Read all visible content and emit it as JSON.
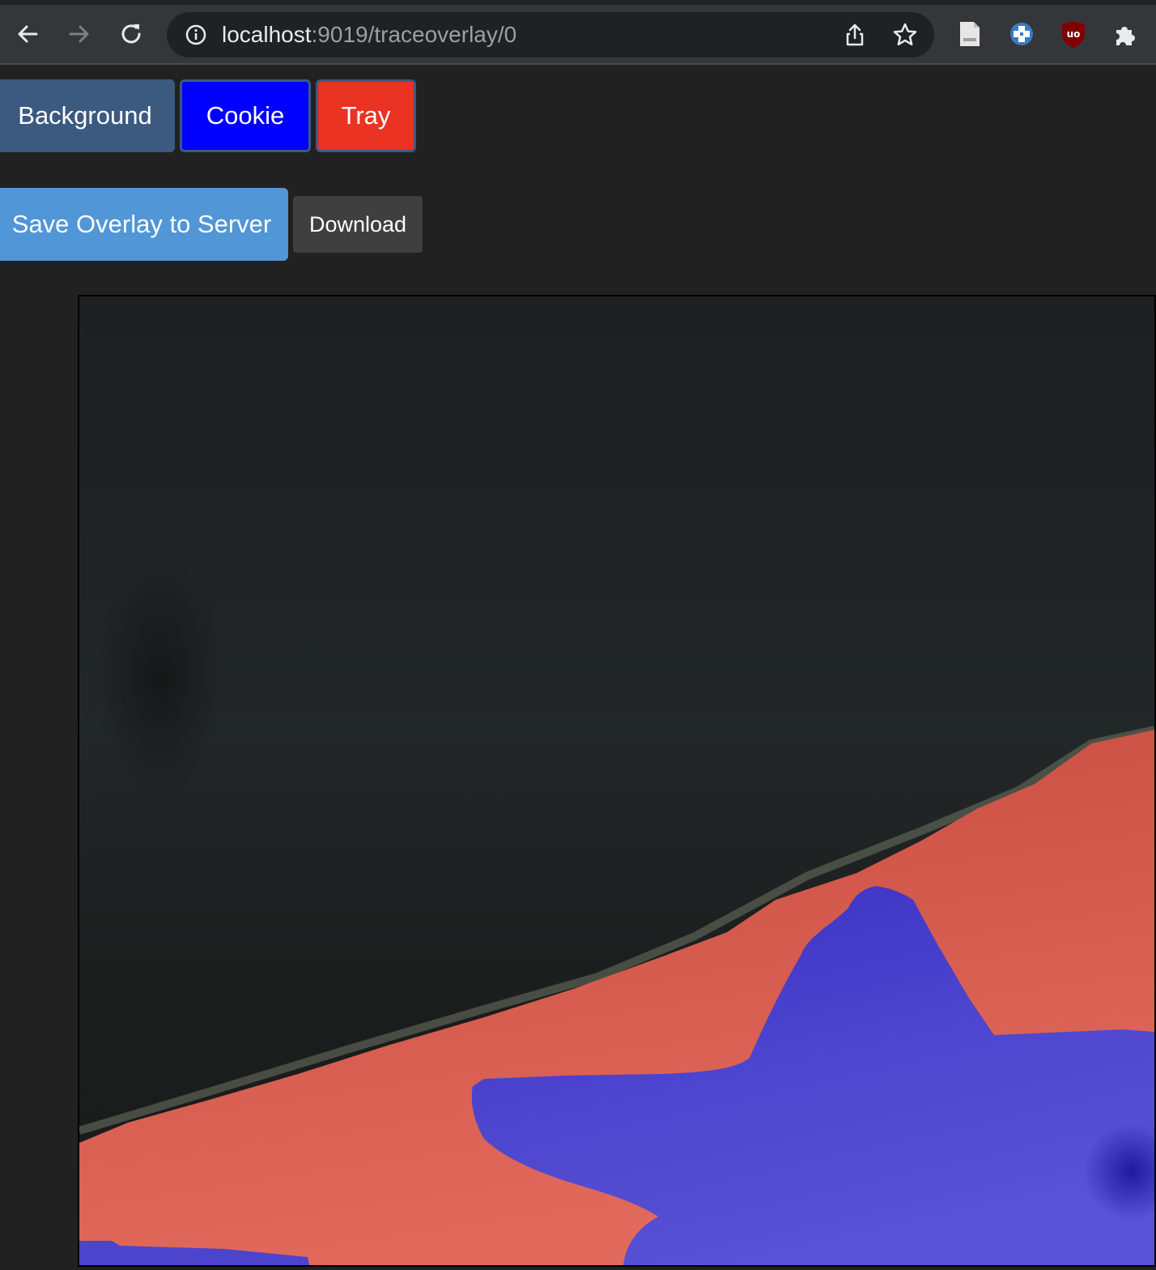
{
  "browser": {
    "url_host": "localhost",
    "url_path": ":9019/traceoverlay/0",
    "nav": [
      "back-icon",
      "forward-icon",
      "reload-icon"
    ],
    "omnibox_icons": [
      "site-info-icon",
      "share-icon",
      "bookmark-star-icon"
    ],
    "extensions": [
      "page-icon",
      "extension-blue-cross-icon",
      "ublock-origin-icon",
      "puzzle-extensions-icon"
    ]
  },
  "toolbar": {
    "labels": [
      "Background",
      "Cookie",
      "Tray"
    ],
    "label_colors": {
      "background": "#3c5a80",
      "cookie": "#0000ff",
      "tray": "#ea3323"
    },
    "save_label": "Save Overlay to Server",
    "download_label": "Download"
  },
  "canvas": {
    "overlay_colors": {
      "tray": "#d9574a",
      "cookie": "#4c44cc",
      "background": "#1e2223"
    }
  }
}
